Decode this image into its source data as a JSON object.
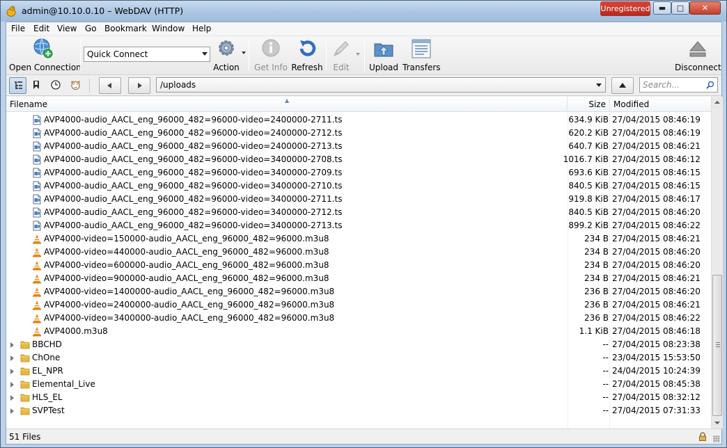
{
  "window": {
    "title": "admin@10.10.0.10 – WebDAV (HTTP)",
    "badge": "Unregistered",
    "controls": [
      "minimize",
      "maximize",
      "close"
    ]
  },
  "menu": [
    "File",
    "Edit",
    "View",
    "Go",
    "Bookmark",
    "Window",
    "Help"
  ],
  "toolbar": {
    "open_connection": "Open Connection",
    "quick_connect": "Quick Connect",
    "action": "Action",
    "get_info": "Get Info",
    "refresh": "Refresh",
    "edit": "Edit",
    "upload": "Upload",
    "transfers": "Transfers",
    "disconnect": "Disconnect"
  },
  "navbar": {
    "path": "/uploads",
    "search_placeholder": "Search..."
  },
  "columns": {
    "filename": "Filename",
    "size": "Size",
    "modified": "Modified"
  },
  "files": [
    {
      "type": "ts",
      "name": "AVP4000-audio_AACL_eng_96000_482=96000-video=2400000-2711.ts",
      "size": "634.9 KiB",
      "modified": "27/04/2015 08:46:19"
    },
    {
      "type": "ts",
      "name": "AVP4000-audio_AACL_eng_96000_482=96000-video=2400000-2712.ts",
      "size": "620.2 KiB",
      "modified": "27/04/2015 08:46:19"
    },
    {
      "type": "ts",
      "name": "AVP4000-audio_AACL_eng_96000_482=96000-video=2400000-2713.ts",
      "size": "640.7 KiB",
      "modified": "27/04/2015 08:46:21"
    },
    {
      "type": "ts",
      "name": "AVP4000-audio_AACL_eng_96000_482=96000-video=3400000-2708.ts",
      "size": "1016.7 KiB",
      "modified": "27/04/2015 08:46:12"
    },
    {
      "type": "ts",
      "name": "AVP4000-audio_AACL_eng_96000_482=96000-video=3400000-2709.ts",
      "size": "693.6 KiB",
      "modified": "27/04/2015 08:46:15"
    },
    {
      "type": "ts",
      "name": "AVP4000-audio_AACL_eng_96000_482=96000-video=3400000-2710.ts",
      "size": "840.5 KiB",
      "modified": "27/04/2015 08:46:15"
    },
    {
      "type": "ts",
      "name": "AVP4000-audio_AACL_eng_96000_482=96000-video=3400000-2711.ts",
      "size": "919.8 KiB",
      "modified": "27/04/2015 08:46:17"
    },
    {
      "type": "ts",
      "name": "AVP4000-audio_AACL_eng_96000_482=96000-video=3400000-2712.ts",
      "size": "840.5 KiB",
      "modified": "27/04/2015 08:46:20"
    },
    {
      "type": "ts",
      "name": "AVP4000-audio_AACL_eng_96000_482=96000-video=3400000-2713.ts",
      "size": "899.2 KiB",
      "modified": "27/04/2015 08:46:22"
    },
    {
      "type": "m3u8",
      "name": "AVP4000-video=150000-audio_AACL_eng_96000_482=96000.m3u8",
      "size": "234 B",
      "modified": "27/04/2015 08:46:21"
    },
    {
      "type": "m3u8",
      "name": "AVP4000-video=440000-audio_AACL_eng_96000_482=96000.m3u8",
      "size": "234 B",
      "modified": "27/04/2015 08:46:20"
    },
    {
      "type": "m3u8",
      "name": "AVP4000-video=600000-audio_AACL_eng_96000_482=96000.m3u8",
      "size": "234 B",
      "modified": "27/04/2015 08:46:20"
    },
    {
      "type": "m3u8",
      "name": "AVP4000-video=900000-audio_AACL_eng_96000_482=96000.m3u8",
      "size": "234 B",
      "modified": "27/04/2015 08:46:21"
    },
    {
      "type": "m3u8",
      "name": "AVP4000-video=1400000-audio_AACL_eng_96000_482=96000.m3u8",
      "size": "236 B",
      "modified": "27/04/2015 08:46:20"
    },
    {
      "type": "m3u8",
      "name": "AVP4000-video=2400000-audio_AACL_eng_96000_482=96000.m3u8",
      "size": "236 B",
      "modified": "27/04/2015 08:46:21"
    },
    {
      "type": "m3u8",
      "name": "AVP4000-video=3400000-audio_AACL_eng_96000_482=96000.m3u8",
      "size": "236 B",
      "modified": "27/04/2015 08:46:22"
    },
    {
      "type": "m3u8",
      "name": "AVP4000.m3u8",
      "size": "1.1 KiB",
      "modified": "27/04/2015 08:46:18"
    },
    {
      "type": "folder",
      "name": "BBCHD",
      "size": "--",
      "modified": "27/04/2015 08:23:38"
    },
    {
      "type": "folder",
      "name": "ChOne",
      "size": "--",
      "modified": "23/04/2015 15:53:50"
    },
    {
      "type": "folder",
      "name": "EL_NPR",
      "size": "--",
      "modified": "24/04/2015 10:24:39"
    },
    {
      "type": "folder",
      "name": "Elemental_Live",
      "size": "--",
      "modified": "27/04/2015 08:45:38"
    },
    {
      "type": "folder",
      "name": "HLS_EL",
      "size": "--",
      "modified": "27/04/2015 08:32:12"
    },
    {
      "type": "folder",
      "name": "SVPTest",
      "size": "--",
      "modified": "27/04/2015 07:31:33"
    }
  ],
  "status": {
    "text": "51 Files"
  },
  "colors": {
    "title_bar": "#a9c4e2",
    "badge": "#c8352a",
    "folder": "#e8b93c",
    "vlc_cone": "#f18a17"
  }
}
